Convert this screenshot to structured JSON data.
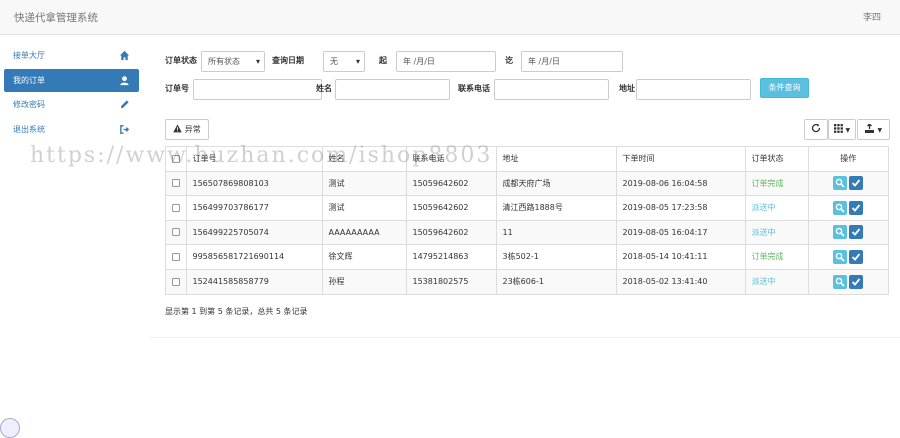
{
  "navbar": {
    "brand": "快递代拿管理系统",
    "user": "李四"
  },
  "sidebar": {
    "items": [
      {
        "label": "接单大厅",
        "icon": "home-icon",
        "active": false
      },
      {
        "label": "我的订单",
        "icon": "user-icon",
        "active": true
      },
      {
        "label": "修改密码",
        "icon": "pencil-icon",
        "active": false
      },
      {
        "label": "退出系统",
        "icon": "logout-icon",
        "active": false
      }
    ]
  },
  "filters": {
    "status_label": "订单状态",
    "status_value": "所有状态",
    "date_label": "查询日期",
    "date_value": "无",
    "from_label": "起",
    "from_placeholder": "年 /月/日",
    "to_label": "讫",
    "to_placeholder": "年 /月/日",
    "order_no_label": "订单号",
    "name_label": "姓名",
    "phone_label": "联系电话",
    "address_label": "地址",
    "search_button": "条件查询"
  },
  "toolbar": {
    "exception_button": "异常"
  },
  "table": {
    "columns": [
      "",
      "订单号",
      "姓名",
      "联系电话",
      "地址",
      "下单时间",
      "订单状态",
      "操作"
    ],
    "rows": [
      {
        "order_no": "156507869808103",
        "name": "测试",
        "phone": "15059642602",
        "address": "成都天府广场",
        "time": "2019-08-06 16:04:58",
        "status": "订单完成",
        "status_type": "done"
      },
      {
        "order_no": "156499703786177",
        "name": "测试",
        "phone": "15059642602",
        "address": "清江西路1888号",
        "time": "2019-08-05 17:23:58",
        "status": "派送中",
        "status_type": "delivering"
      },
      {
        "order_no": "156499225705074",
        "name": "AAAAAAAAA",
        "phone": "15059642602",
        "address": "11",
        "time": "2019-08-05 16:04:17",
        "status": "派送中",
        "status_type": "delivering"
      },
      {
        "order_no": "995856581721690114",
        "name": "徐文辉",
        "phone": "14795214863",
        "address": "3栋502-1",
        "time": "2018-05-14 10:41:11",
        "status": "订单完成",
        "status_type": "done"
      },
      {
        "order_no": "152441585858779",
        "name": "孙程",
        "phone": "15381802575",
        "address": "23栋606-1",
        "time": "2018-05-02 13:41:40",
        "status": "派送中",
        "status_type": "delivering"
      }
    ]
  },
  "pagination": {
    "info": "显示第 1 到第 5 条记录，总共 5 条记录"
  },
  "watermark": "https://www.huzhan.com/ishop8803",
  "colors": {
    "primary": "#337ab7",
    "info": "#5bc0de",
    "success": "#5cb85c"
  }
}
